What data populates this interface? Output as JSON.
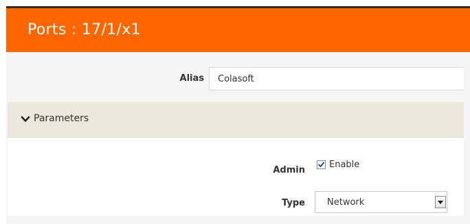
{
  "dialog": {
    "title": "Ports : 17/1/x1"
  },
  "alias": {
    "label": "Alias",
    "value": "Colasoft"
  },
  "parameters": {
    "section_label": "Parameters",
    "expanded": true,
    "admin": {
      "label": "Admin",
      "checkbox_label": "Enable",
      "checked": true
    },
    "type": {
      "label": "Type",
      "selected": "Network"
    }
  },
  "colors": {
    "header": "#ff6600",
    "section_bar": "#ece9dc",
    "text": "#333333"
  },
  "icons": {
    "section_toggle": "chevron-down-icon",
    "checkbox_mark": "checkmark-icon",
    "select_arrow": "caret-down-icon"
  }
}
